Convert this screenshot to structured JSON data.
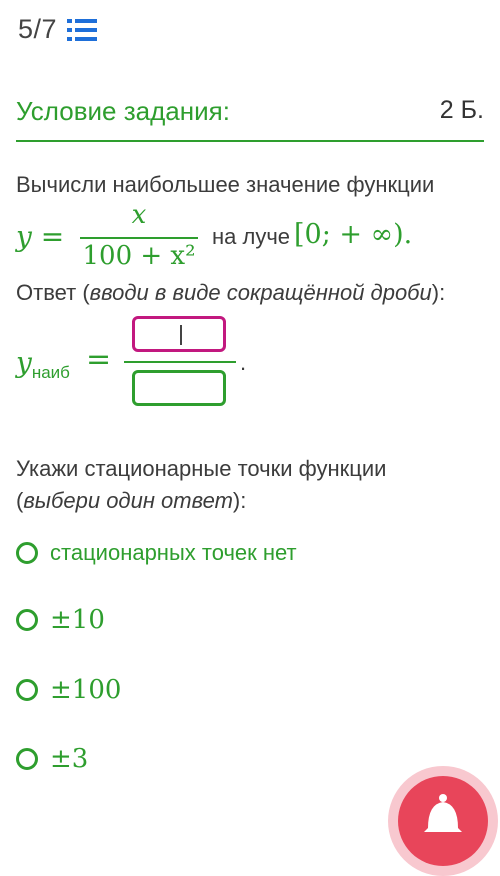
{
  "header": {
    "progress": "5/7",
    "list_icon": "list-icon"
  },
  "condition": {
    "title": "Условие задания:",
    "points": "2 Б."
  },
  "task": {
    "prompt": "Вычисли наибольшее значение функции",
    "y_eq": "y =",
    "numerator": "x",
    "denominator": "100 + x²",
    "ray_text": "на луче",
    "interval": "[0; + ∞).",
    "answer_prefix": "Ответ (",
    "answer_hint": "вводи в виде сокращённой дроби",
    "answer_suffix": "):",
    "y_max_var": "y",
    "y_max_sub": "наиб",
    "equals": "=",
    "period": "."
  },
  "question2": {
    "line1": "Укажи стационарные точки функции",
    "paren_open": "(",
    "hint": "выбери один ответ",
    "paren_close": "):"
  },
  "options": [
    {
      "label": "стационарных точек нет"
    },
    {
      "label": "±10"
    },
    {
      "label": "±100"
    },
    {
      "label": "±3"
    }
  ],
  "colors": {
    "accent": "#2e9e2e",
    "active_input": "#c2187f",
    "fab": "#e8455a"
  },
  "fab_icon": "bell-icon"
}
